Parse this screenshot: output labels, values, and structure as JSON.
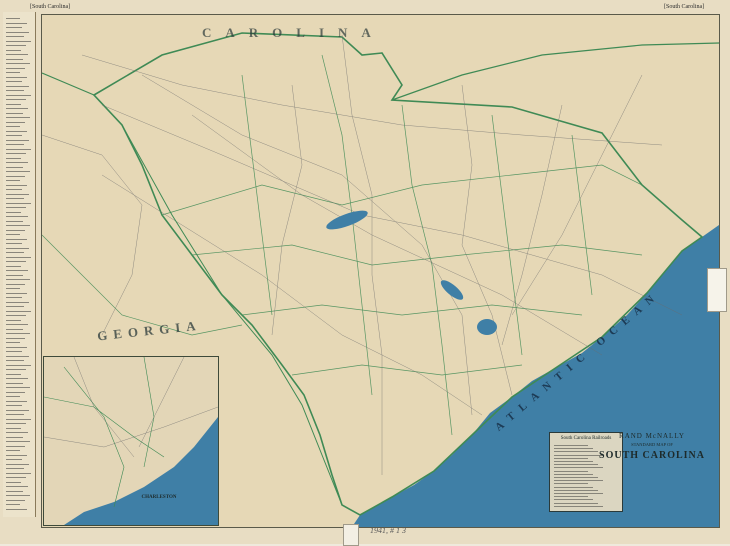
{
  "header": {
    "left_title": "[South Carolina]",
    "right_title": "[South Carolina]"
  },
  "title_block": {
    "publisher": "RAND McNALLY",
    "subtitle": "STANDARD MAP OF",
    "state": "SOUTH CAROLINA"
  },
  "labels": {
    "georgia": "GEORGIA",
    "north_carolina": "CAROLINA",
    "ocean": "ATLANTIC OCEAN"
  },
  "legend": {
    "title": "South Carolina Railroads"
  },
  "inset": {
    "caption": "CHARLESTON"
  },
  "colors": {
    "paper": "#e8ddc3",
    "ocean": "#3f7fa6",
    "border_green": "#3f8a55",
    "road_gray": "#6b6b6b"
  },
  "annotation": {
    "handwritten": "1941, # 1 3"
  }
}
